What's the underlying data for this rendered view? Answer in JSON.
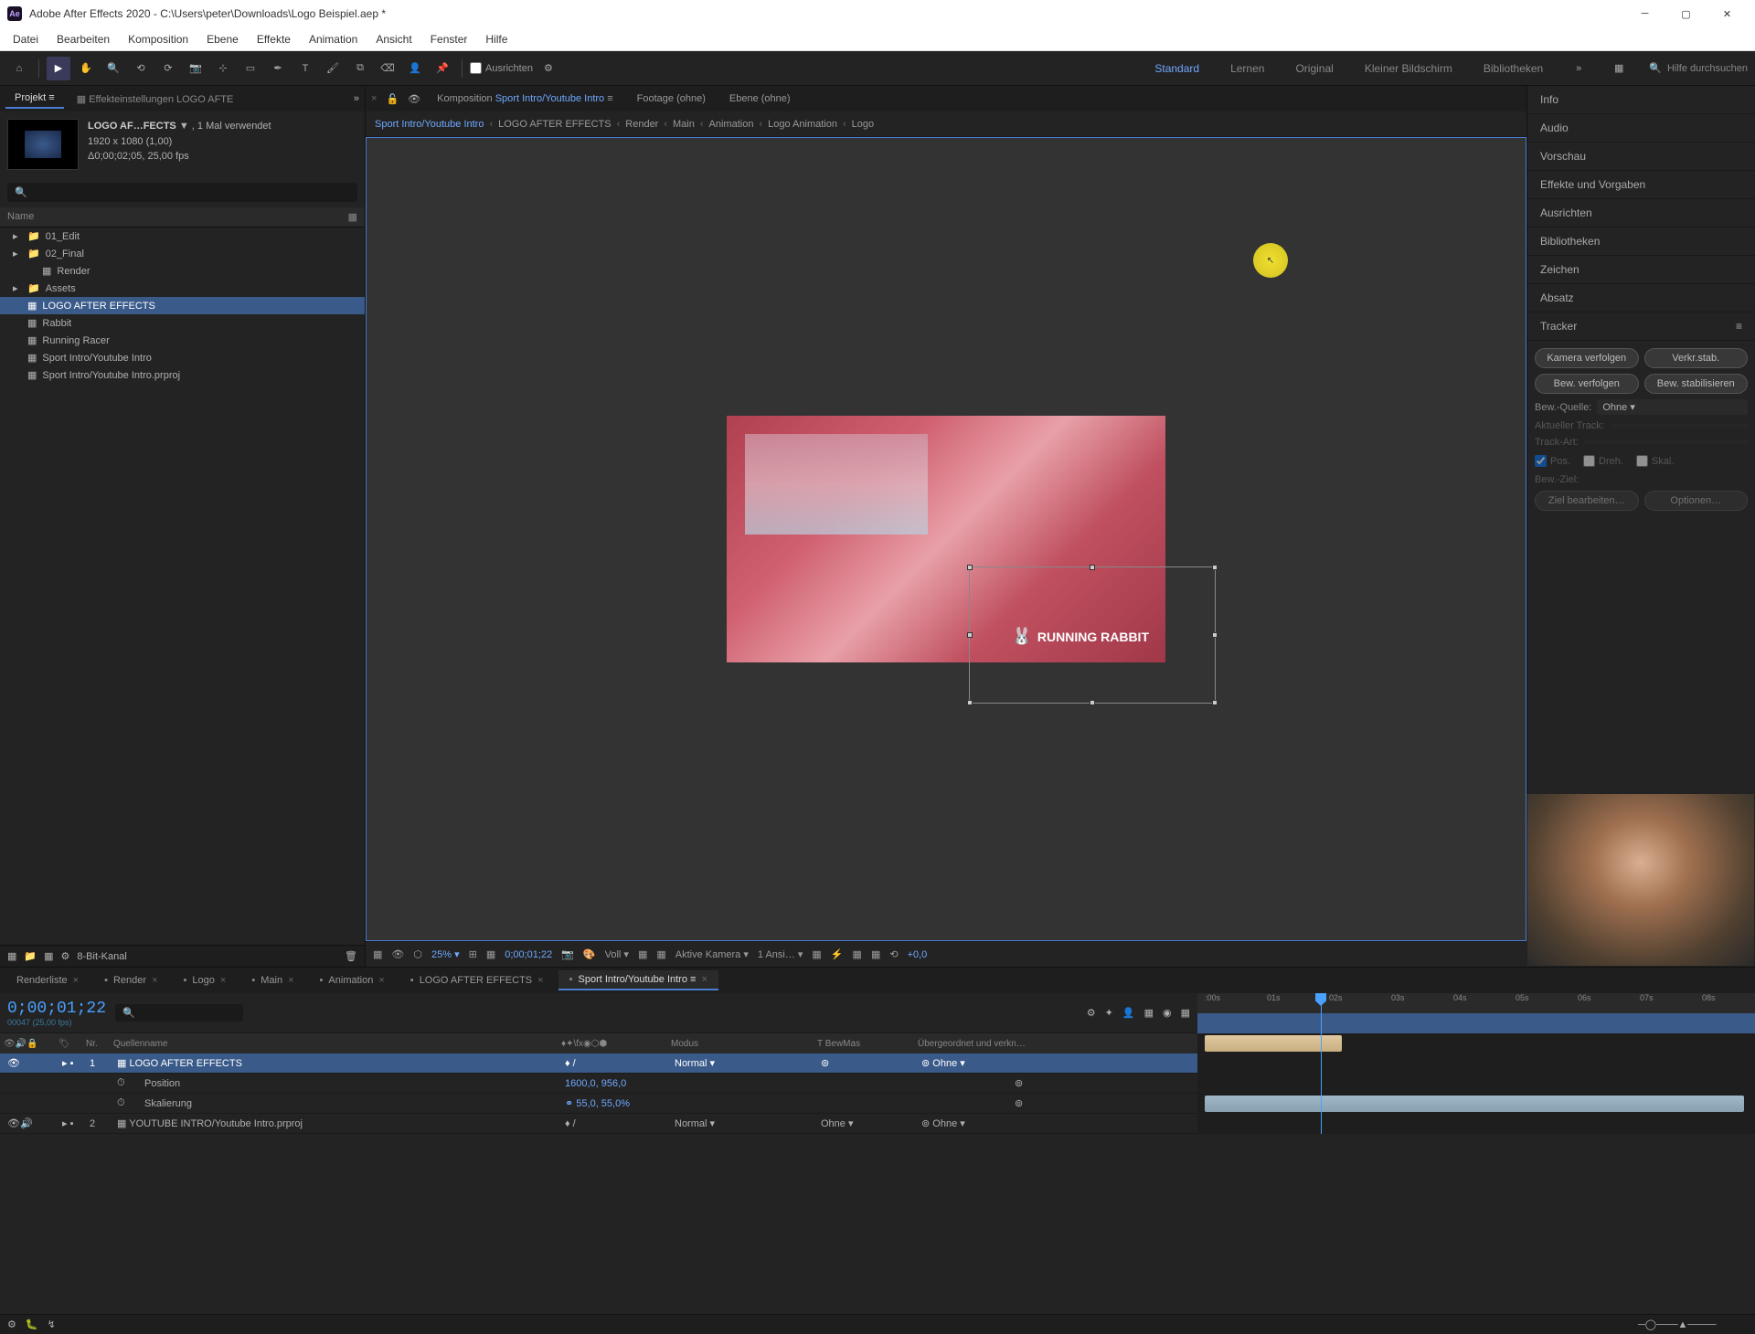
{
  "titlebar": {
    "app_icon": "Ae",
    "title": "Adobe After Effects 2020 - C:\\Users\\peter\\Downloads\\Logo Beispiel.aep *"
  },
  "menu": [
    "Datei",
    "Bearbeiten",
    "Komposition",
    "Ebene",
    "Effekte",
    "Animation",
    "Ansicht",
    "Fenster",
    "Hilfe"
  ],
  "toolbar": {
    "ausrichten": "Ausrichten",
    "workspaces": [
      "Standard",
      "Lernen",
      "Original",
      "Kleiner Bildschirm",
      "Bibliotheken"
    ],
    "search_placeholder": "Hilfe durchsuchen"
  },
  "project_panel": {
    "tab_project": "Projekt",
    "tab_effects": "Effekteinstellungen  LOGO AFTE",
    "asset_name": "LOGO AF…FECTS",
    "asset_used": "1 Mal verwendet",
    "asset_res": "1920 x 1080 (1,00)",
    "asset_dur": "Δ0;00;02;05, 25,00 fps",
    "col_name": "Name",
    "items": [
      {
        "label": "01_Edit",
        "type": "folder",
        "indent": 0
      },
      {
        "label": "02_Final",
        "type": "folder",
        "indent": 0
      },
      {
        "label": "Render",
        "type": "comp",
        "indent": 1
      },
      {
        "label": "Assets",
        "type": "folder",
        "indent": 0
      },
      {
        "label": "LOGO AFTER EFFECTS",
        "type": "comp",
        "indent": 0,
        "selected": true
      },
      {
        "label": "Rabbit",
        "type": "comp",
        "indent": 0
      },
      {
        "label": "Running Racer",
        "type": "comp",
        "indent": 0
      },
      {
        "label": "Sport Intro/Youtube Intro",
        "type": "comp",
        "indent": 0
      },
      {
        "label": "Sport Intro/Youtube Intro.prproj",
        "type": "prproj",
        "indent": 0
      }
    ],
    "bit_depth": "8-Bit-Kanal"
  },
  "comp_panel": {
    "tab_comp": "Komposition",
    "tab_comp_name": "Sport Intro/Youtube Intro",
    "tab_footage": "Footage  (ohne)",
    "tab_layer": "Ebene  (ohne)",
    "breadcrumbs": [
      "Sport Intro/Youtube Intro",
      "LOGO AFTER EFFECTS",
      "Render",
      "Main",
      "Animation",
      "Logo Animation",
      "Logo"
    ],
    "logo_text": "RUNNING RABBIT",
    "controls": {
      "zoom": "25%",
      "time": "0;00;01;22",
      "resolution": "Voll",
      "camera": "Aktive Kamera",
      "views": "1 Ansi…",
      "exposure": "+0,0"
    }
  },
  "right_panels": [
    "Info",
    "Audio",
    "Vorschau",
    "Effekte und Vorgaben",
    "Ausrichten",
    "Bibliotheken",
    "Zeichen",
    "Absatz"
  ],
  "tracker": {
    "title": "Tracker",
    "btn_track_cam": "Kamera verfolgen",
    "btn_warp": "Verkr.stab.",
    "btn_track_motion": "Bew. verfolgen",
    "btn_stabilize": "Bew. stabilisieren",
    "source_label": "Bew.-Quelle:",
    "source_value": "Ohne",
    "current_track": "Aktueller Track:",
    "track_type": "Track-Art:",
    "chk_pos": "Pos.",
    "chk_rot": "Dreh.",
    "chk_scale": "Skal.",
    "target": "Bew.-Ziel:",
    "btn_edit_target": "Ziel bearbeiten…",
    "btn_options": "Optionen…"
  },
  "timeline": {
    "tabs": [
      "Renderliste",
      "Render",
      "Logo",
      "Main",
      "Animation",
      "LOGO AFTER EFFECTS",
      "Sport Intro/Youtube Intro"
    ],
    "active_tab": 6,
    "timecode": "0;00;01;22",
    "timecode_sub": "00047 (25,00 fps)",
    "col_nr": "Nr.",
    "col_quellenname": "Quellenname",
    "col_modus": "Modus",
    "col_bewmas": "BewMas",
    "col_parent": "Übergeordnet und verkn…",
    "layers": [
      {
        "nr": "1",
        "name": "LOGO AFTER EFFECTS",
        "mode": "Normal",
        "parent": "Ohne",
        "selected": true
      },
      {
        "nr": "2",
        "name": "YOUTUBE INTRO/Youtube Intro.prproj",
        "mode": "Normal",
        "bewmas": "Ohne",
        "parent": "Ohne"
      }
    ],
    "props": [
      {
        "name": "Position",
        "value": "1600,0, 956,0"
      },
      {
        "name": "Skalierung",
        "value": "55,0, 55,0%"
      }
    ],
    "ruler": [
      ":00s",
      "01s",
      "02s",
      "03s",
      "04s",
      "05s",
      "06s",
      "07s",
      "08s"
    ]
  }
}
